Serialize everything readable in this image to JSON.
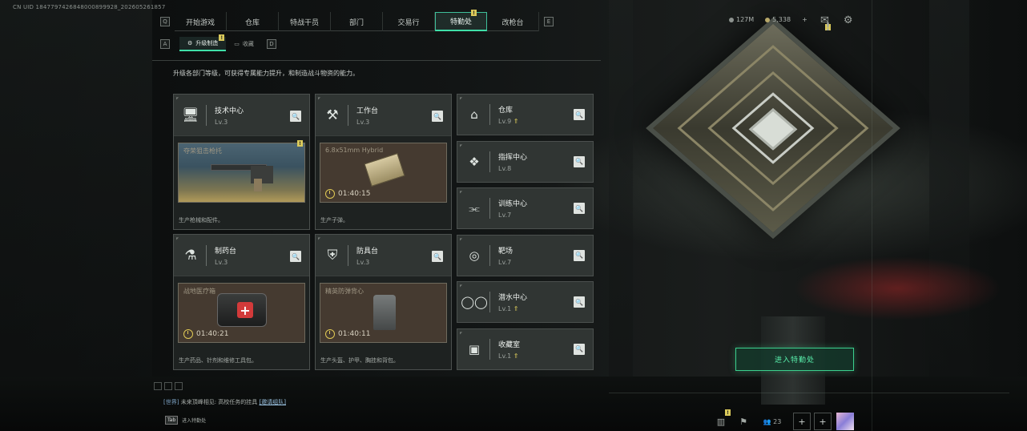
{
  "uid": "CN UID 1847797426848000899928_202605261857",
  "nav": {
    "tabs": [
      {
        "label": "开始游戏",
        "active": false,
        "badge": ""
      },
      {
        "label": "仓库",
        "active": false,
        "badge": ""
      },
      {
        "label": "特战干员",
        "active": false,
        "badge": ""
      },
      {
        "label": "部门",
        "active": false,
        "badge": ""
      },
      {
        "label": "交易行",
        "active": false,
        "badge": ""
      },
      {
        "label": "特勤处",
        "active": true,
        "badge": "!"
      },
      {
        "label": "改枪台",
        "active": false,
        "badge": ""
      }
    ],
    "left_key": "Q",
    "right_key": "E"
  },
  "subnav": {
    "left_key": "A",
    "right_key": "D",
    "tabs": [
      {
        "label": "升级制造",
        "active": true,
        "badge": "!"
      },
      {
        "label": "收藏",
        "active": false
      }
    ]
  },
  "currency": {
    "coins": "127M",
    "tickets": "5,338",
    "plus": "+"
  },
  "top_badge": "!",
  "description": "升级各部门等级，可获得专属能力提升，和制造战斗物资的能力。",
  "large_cards": [
    {
      "title": "技术中心",
      "level": "Lv.3",
      "icon": "computer-icon",
      "glyph": "🖥",
      "product": "夺荣狙击枪托",
      "timer": "",
      "badge": "!",
      "footer": "生产枪械和配件。",
      "style": "gold"
    },
    {
      "title": "工作台",
      "level": "Lv.3",
      "icon": "tools-icon",
      "glyph": "⚒",
      "product": "6.8x51mm Hybrid",
      "timer": "01:40:15",
      "badge": "",
      "footer": "生产子弹。",
      "style": "brown"
    },
    {
      "title": "制药台",
      "level": "Lv.3",
      "icon": "microscope-icon",
      "glyph": "⚗",
      "product": "战地医疗箱",
      "timer": "01:40:21",
      "badge": "",
      "footer": "生产药品、针剂和维修工具包。",
      "style": "brown"
    },
    {
      "title": "防具台",
      "level": "Lv.3",
      "icon": "armor-icon",
      "glyph": "⛨",
      "product": "精英防弹背心",
      "timer": "01:40:11",
      "badge": "",
      "footer": "生产头盔、护甲、胸挂和背包。",
      "style": "brown"
    }
  ],
  "small_cards": [
    {
      "title": "仓库",
      "level": "Lv.9",
      "icon": "warehouse-icon",
      "glyph": "⌂",
      "upgrade": true
    },
    {
      "title": "指挥中心",
      "level": "Lv.8",
      "icon": "command-chip-icon",
      "glyph": "❖",
      "upgrade": false
    },
    {
      "title": "训练中心",
      "level": "Lv.7",
      "icon": "dumbbell-icon",
      "glyph": "⫘",
      "upgrade": false
    },
    {
      "title": "靶场",
      "level": "Lv.7",
      "icon": "target-icon",
      "glyph": "◎",
      "upgrade": false
    },
    {
      "title": "潜水中心",
      "level": "Lv.1",
      "icon": "goggles-icon",
      "glyph": "◯◯",
      "upgrade": true
    },
    {
      "title": "收藏室",
      "level": "Lv.1",
      "icon": "portrait-icon",
      "glyph": "▣",
      "upgrade": true
    }
  ],
  "enter_button": "进入特勤处",
  "chat": {
    "channel": "[世界]",
    "text": "未来頂峰相见: 高校任务的挂具",
    "link": "[邀请组队]"
  },
  "tab_hint": {
    "key": "Tab",
    "label": "进入特勤处"
  },
  "bottom_bar": {
    "friends": "23",
    "badge": "!"
  },
  "colors": {
    "accent": "#3fdfa8",
    "badge": "#d9c95a",
    "panel": "#202423"
  }
}
